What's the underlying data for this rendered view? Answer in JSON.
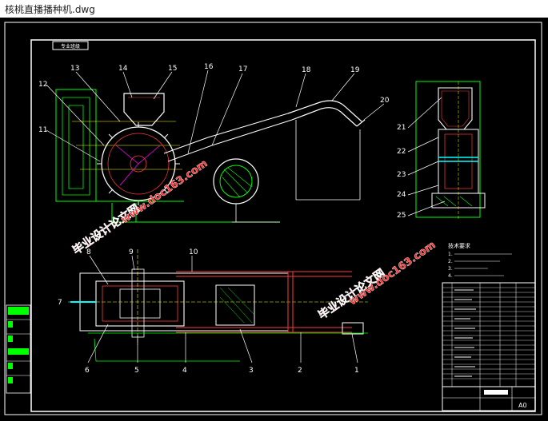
{
  "window": {
    "title": "核桃直播播种机.dwg"
  },
  "drawing": {
    "stamp_top": "专业班级",
    "part_numbers_main": [
      "13",
      "14",
      "15",
      "16",
      "17",
      "18",
      "19",
      "20",
      "12",
      "11"
    ],
    "part_numbers_side": [
      "21",
      "22",
      "23",
      "24",
      "25"
    ],
    "part_numbers_plan": [
      "8",
      "9",
      "10",
      "7",
      "6",
      "5",
      "4",
      "3",
      "2",
      "1"
    ],
    "watermark_cn": "毕业设计论文网",
    "watermark_url": "www.doc163.com",
    "tech_notes_title": "技术要求",
    "tech_notes": [
      "1.",
      "2.",
      "3.",
      "4."
    ],
    "title_block_size": "A0"
  },
  "colors": {
    "background": "#000000",
    "frame": "#ffffff",
    "part_green": "#00ff00",
    "part_red": "#ff3b3b",
    "part_yellow": "#ffff00",
    "part_cyan": "#00ffff",
    "part_magenta": "#ff00ff",
    "watermark_red": "#ff2a2a"
  }
}
